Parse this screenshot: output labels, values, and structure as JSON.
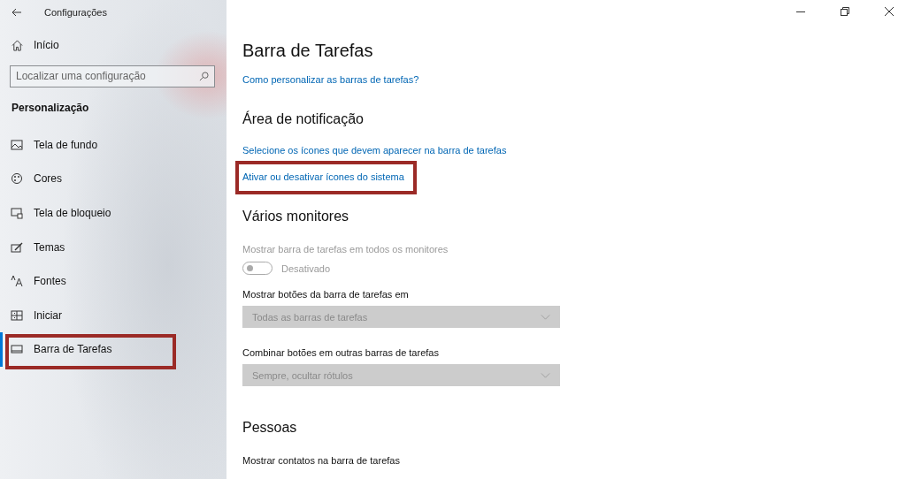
{
  "window": {
    "title": "Configurações"
  },
  "sidebar": {
    "home": "Início",
    "search": {
      "placeholder": "Localizar uma configuração"
    },
    "section": "Personalização",
    "items": [
      {
        "label": "Tela de fundo",
        "kind": "picture",
        "selected": false,
        "highlighted": false
      },
      {
        "label": "Cores",
        "kind": "palette",
        "selected": false,
        "highlighted": false
      },
      {
        "label": "Tela de bloqueio",
        "kind": "lock",
        "selected": false,
        "highlighted": false
      },
      {
        "label": "Temas",
        "kind": "brush",
        "selected": false,
        "highlighted": false
      },
      {
        "label": "Fontes",
        "kind": "font",
        "selected": false,
        "highlighted": false
      },
      {
        "label": "Iniciar",
        "kind": "start",
        "selected": false,
        "highlighted": false
      },
      {
        "label": "Barra de Tarefas",
        "kind": "taskbar",
        "selected": true,
        "highlighted": true
      }
    ]
  },
  "main": {
    "title": "Barra de Tarefas",
    "blocks": [
      {
        "kind": "link",
        "text": "Como personalizar as barras de tarefas?",
        "highlighted": false
      },
      {
        "kind": "heading",
        "text": "Área de notificação"
      },
      {
        "kind": "link",
        "text": "Selecione os ícones que devem aparecer na barra de tarefas",
        "highlighted": false
      },
      {
        "kind": "link",
        "text": "Ativar ou desativar ícones do sistema",
        "highlighted": true
      },
      {
        "kind": "heading",
        "text": "Vários monitores"
      },
      {
        "kind": "label",
        "text": "Mostrar barra de tarefas em todos os monitores",
        "disabled": true
      },
      {
        "kind": "toggle",
        "text": "Desativado",
        "on": false,
        "disabled": true
      },
      {
        "kind": "label",
        "text": "Mostrar botões da barra de tarefas em",
        "disabled": false
      },
      {
        "kind": "dropdown",
        "value": "Todas as barras de tarefas",
        "disabled": true
      },
      {
        "kind": "label",
        "text": "Combinar botões em outras barras de tarefas",
        "disabled": false
      },
      {
        "kind": "dropdown",
        "value": "Sempre, ocultar rótulos",
        "disabled": true
      },
      {
        "kind": "heading",
        "text": "Pessoas"
      },
      {
        "kind": "label",
        "text": "Mostrar contatos na barra de tarefas",
        "disabled": false
      }
    ]
  }
}
